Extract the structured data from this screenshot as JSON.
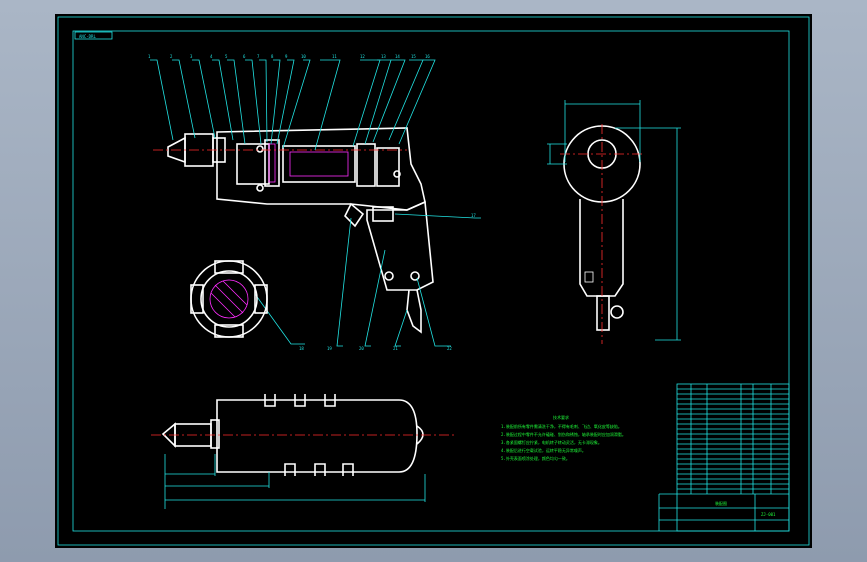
{
  "drawing": {
    "corner_tag": "ANC-DRL",
    "leaders": [
      "1",
      "2",
      "3",
      "4",
      "5",
      "6",
      "7",
      "8",
      "9",
      "10",
      "11",
      "12",
      "13",
      "14",
      "15",
      "16",
      "17",
      "18",
      "19",
      "20",
      "21",
      "22"
    ],
    "technical_requirements": {
      "heading": "技术要求",
      "lines": [
        "1.装配前所有零件需清洗干净，不得有毛刺、飞边、氧化皮等缺陷。",
        "2.装配过程中零件不允许磕碰、划伤和锈蚀，轴承装配时应加润滑脂。",
        "3.各紧固螺钉应拧紧，电机转子转动灵活，无卡滞现象。",
        "4.装配后进行空载试验，运转平稳无异常噪声。",
        "5.外壳表面喷涂处理，颜色均匀一致。"
      ]
    },
    "title_block": {
      "title": "装配图",
      "drawing_no": "ZJ-001"
    },
    "colors": {
      "background": "#000000",
      "outline": "#ffffff",
      "dimension": "#21e3e3",
      "centerline": "#ff2d2d",
      "hatch": "#ff2dff",
      "notes": "#1fff3a"
    }
  }
}
